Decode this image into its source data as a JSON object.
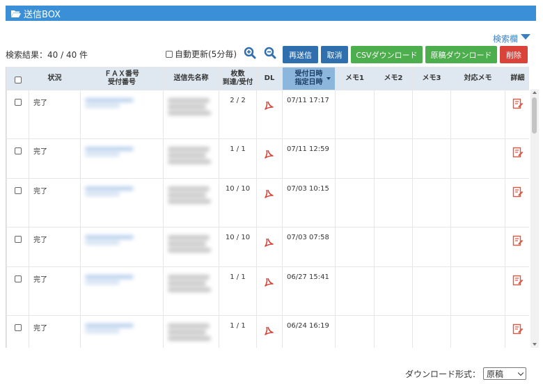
{
  "header": {
    "title": "送信BOX",
    "icon": "folder-open-icon"
  },
  "search_toggle": {
    "label": "検索欄"
  },
  "result_count": "検索結果：40 / 40 件",
  "auto_refresh": {
    "label": "自動更新(5分毎)",
    "checked": false
  },
  "toolbar": {
    "resend": "再送信",
    "cancel": "取消",
    "csv_download": "CSVダウンロード",
    "original_download": "原稿ダウンロード",
    "delete": "削除"
  },
  "columns": {
    "status": "状況",
    "fax_top": "ＦＡＸ番号",
    "fax_bottom": "受付番号",
    "recipient": "送信先名称",
    "pages_top": "枚数",
    "pages_bottom": "到達/受付",
    "dl": "DL",
    "date_top": "受付日時",
    "date_bottom": "指定日時",
    "memo1": "メモ1",
    "memo2": "メモ2",
    "memo3": "メモ3",
    "memo_action": "対応メモ",
    "detail": "詳細"
  },
  "rows": [
    {
      "status": "完了",
      "pages": "2 / 2",
      "date": "07/11 17:17"
    },
    {
      "status": "完了",
      "pages": "1 / 1",
      "date": "07/11 12:59"
    },
    {
      "status": "完了",
      "pages": "10 / 10",
      "date": "07/03 10:15"
    },
    {
      "status": "完了",
      "pages": "10 / 10",
      "date": "07/03 07:58"
    },
    {
      "status": "完了",
      "pages": "1 / 1",
      "date": "06/27 15:41"
    },
    {
      "status": "完了",
      "pages": "1 / 1",
      "date": "06/24 16:19"
    }
  ],
  "download_format": {
    "label": "ダウンロード形式：",
    "selected": "原稿"
  },
  "colors": {
    "accent": "#3a8fd6",
    "button_blue": "#2f6fad",
    "button_green": "#4cae4c",
    "button_red": "#d9433a",
    "sorted_header": "#8db6dd"
  }
}
